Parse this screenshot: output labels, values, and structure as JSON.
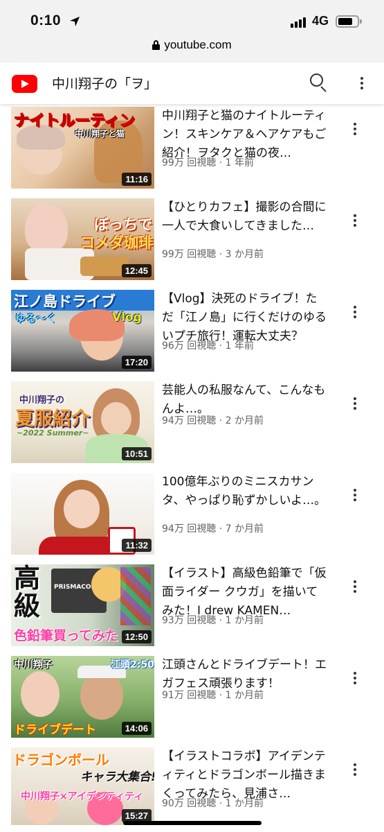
{
  "status_bar": {
    "time": "0:10",
    "network": "4G"
  },
  "browser": {
    "url": "youtube.com"
  },
  "header": {
    "channel_title": "中川翔子の「ヲ」"
  },
  "colors": {
    "brand_red": "#ff0000",
    "meta_gray": "#606060"
  },
  "videos": [
    {
      "title": "中川翔子と猫のナイトルーティン！スキンケア＆ヘアケアもご紹介！ヲタクと猫の夜…",
      "meta": "99万 回視聴 · 1 年前",
      "duration": "11:16",
      "thumb_text_1": "ナイトルーティン",
      "thumb_text_2": "中川翔子と猫"
    },
    {
      "title": "【ひとりカフェ】撮影の合間に一人で大食いしてきました…",
      "meta": "99万 回視聴 · 3 か月前",
      "duration": "12:45",
      "thumb_text_1": "ぼっちで",
      "thumb_text_2": "コメダ珈琲"
    },
    {
      "title": "【Vlog】決死のドライブ！ただ「江ノ島」に行くだけのゆるいプチ旅行！運転大丈夫？",
      "meta": "96万 回視聴 · 1 年前",
      "duration": "17:20",
      "thumb_text_1": "江ノ島ドライブ",
      "thumb_text_2": "ゆる〜く",
      "thumb_text_3": "Vlog"
    },
    {
      "title": "芸能人の私服なんて、こんなもんよ…。",
      "meta": "94万 回視聴 · 2 か月前",
      "duration": "10:51",
      "thumb_text_1": "中川翔子の",
      "thumb_text_2": "夏服紹介",
      "thumb_text_3": "~2022 Summer~"
    },
    {
      "title": "100億年ぶりのミニスカサンタ、やっぱり恥ずかしいよ…。",
      "meta": "94万 回視聴 · 7 か月前",
      "duration": "11:32"
    },
    {
      "title": "【イラスト】高級色鉛筆で「仮面ライダー クウガ」を描いてみた！I drew KAMEN…",
      "meta": "93万 回視聴 · 1 か月前",
      "duration": "12:50",
      "thumb_text_1": "高級",
      "thumb_text_2": "色鉛筆買ってみた",
      "thumb_text_3": "PRISMACOLOR"
    },
    {
      "title": "江頭さんとドライブデート！エガフェス頑張ります！",
      "meta": "91万 回視聴 · 1 か月前",
      "duration": "14:06",
      "thumb_text_1": "中川翔子",
      "thumb_text_2": "江頭2:50",
      "thumb_text_3": "ドライブデート"
    },
    {
      "title": "【イラストコラボ】アイデンティティとドラゴンボール描きまくってみたら、見浦さ…",
      "meta": "90万 回視聴 · 1 か月前",
      "duration": "15:27",
      "thumb_text_1": "ドラゴンボール",
      "thumb_text_2": "キャラ大集合!!",
      "thumb_text_3": "中川翔子×アイデンティティ"
    }
  ]
}
